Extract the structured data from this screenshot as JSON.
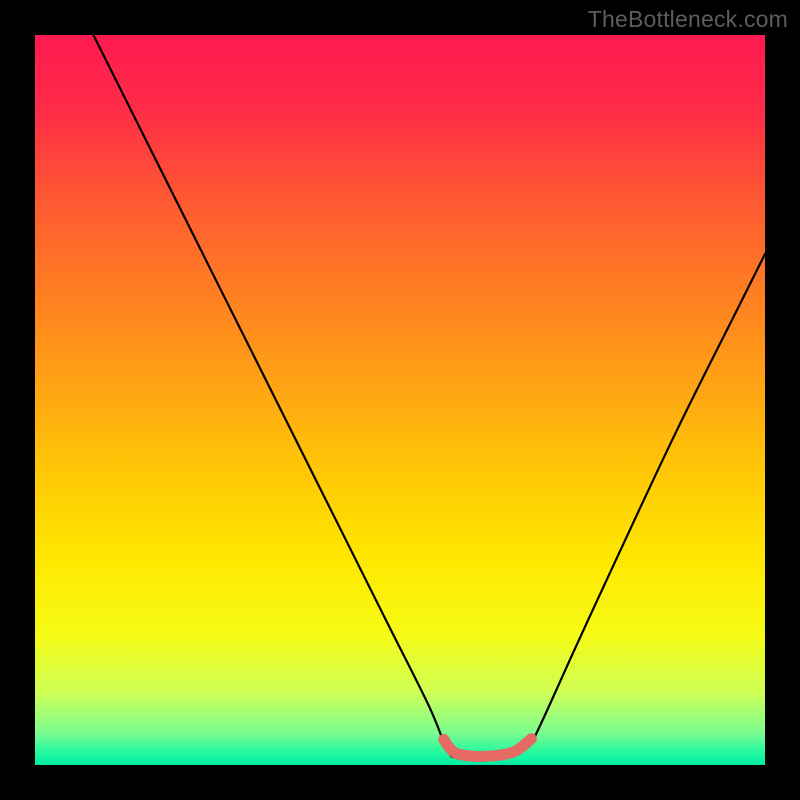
{
  "watermark": "TheBottleneck.com",
  "gradient": {
    "stops": [
      {
        "offset": 0.0,
        "color": "#ff1a50"
      },
      {
        "offset": 0.1,
        "color": "#ff2b47"
      },
      {
        "offset": 0.22,
        "color": "#ff5733"
      },
      {
        "offset": 0.35,
        "color": "#ff7d22"
      },
      {
        "offset": 0.48,
        "color": "#ffa314"
      },
      {
        "offset": 0.6,
        "color": "#ffc805"
      },
      {
        "offset": 0.72,
        "color": "#ffe800"
      },
      {
        "offset": 0.82,
        "color": "#f6fb15"
      },
      {
        "offset": 0.9,
        "color": "#cfff55"
      },
      {
        "offset": 0.955,
        "color": "#7dfd8f"
      },
      {
        "offset": 0.985,
        "color": "#1ef8a0"
      },
      {
        "offset": 1.0,
        "color": "#02eca5"
      }
    ]
  },
  "chart_data": {
    "type": "line",
    "title": "",
    "xlabel": "",
    "ylabel": "",
    "xlim": [
      0,
      100
    ],
    "ylim": [
      0,
      100
    ],
    "series": [
      {
        "name": "bottleneck-curve",
        "x": [
          8,
          12,
          18,
          25,
          32,
          40,
          48,
          54,
          56.5,
          58,
          62,
          65,
          67.5,
          69,
          74,
          80,
          88,
          96,
          100
        ],
        "values": [
          100,
          92,
          80,
          66,
          52,
          36,
          20,
          8,
          2,
          1,
          1,
          1.5,
          2.5,
          5,
          16,
          29,
          46,
          62,
          70
        ]
      }
    ],
    "highlight_segment": {
      "comment": "thick salmon line across the valley floor",
      "x": [
        56,
        57,
        58,
        60,
        62,
        64,
        66,
        68
      ],
      "values": [
        3.5,
        2.1,
        1.5,
        1.2,
        1.2,
        1.4,
        2.0,
        3.6
      ],
      "color": "#e46a63"
    }
  }
}
